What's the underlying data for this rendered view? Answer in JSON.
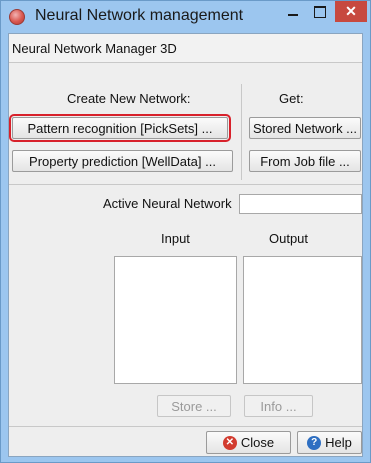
{
  "window": {
    "title": "Neural Network management",
    "minimize_glyph": "",
    "maximize_glyph": "",
    "close_glyph": "✕"
  },
  "header": {
    "subtitle": "Neural Network Manager 3D"
  },
  "create": {
    "heading": "Create New Network:",
    "pattern_button": "Pattern recognition [PickSets] ...",
    "property_button": "Property prediction [WellData] ..."
  },
  "get": {
    "heading": "Get:",
    "stored_button": "Stored Network ...",
    "job_button": "From Job file ..."
  },
  "active": {
    "label": "Active Neural Network",
    "value": ""
  },
  "io": {
    "input_label": "Input",
    "output_label": "Output"
  },
  "actions": {
    "store_button": "Store ...",
    "info_button": "Info ..."
  },
  "footer": {
    "close_button": "Close",
    "help_button": "Help",
    "close_icon_glyph": "✕",
    "help_icon_glyph": "?"
  },
  "colors": {
    "titlebar": "#9cc6ef",
    "close_button": "#c7493f",
    "highlight_outline": "#d8212b",
    "panel": "#eeeeee"
  },
  "icons": [
    "app-icon",
    "minimize-icon",
    "maximize-icon",
    "close-icon",
    "help-icon"
  ]
}
